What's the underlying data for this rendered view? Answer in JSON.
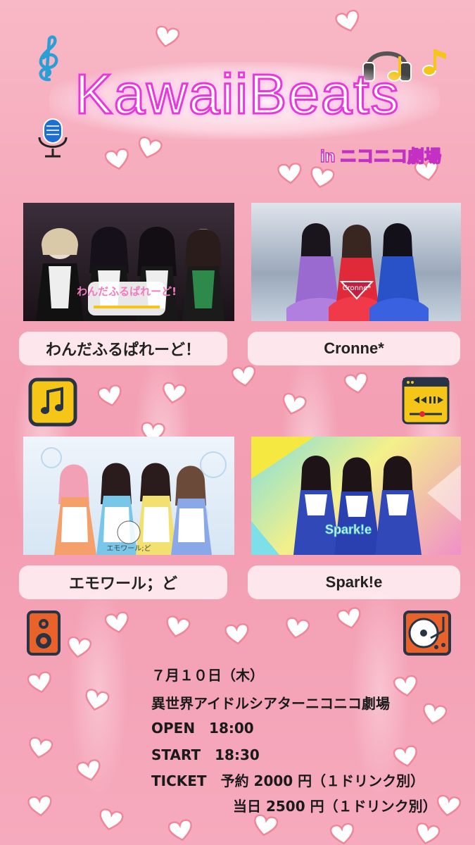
{
  "event": {
    "title": "KawaiiBeats",
    "subtitle": "in ニコニコ劇場"
  },
  "performers": [
    {
      "name": "わんだふるぱれーど！",
      "logo_text": "わんだふるぱれーど!"
    },
    {
      "name": "Cronne*",
      "logo_text": "Cronne*"
    },
    {
      "name": "エモワール；ど",
      "logo_text": "エモワール;ど"
    },
    {
      "name": "Spark!e",
      "logo_text": "Spark!e"
    }
  ],
  "details": {
    "date": "７月１０日（木）",
    "venue": "異世界アイドルシアターニコニコ劇場",
    "open": "OPEN　18:00",
    "start": "START　18:30",
    "ticket_advance": "TICKET　予約 2000 円（１ドリンク別）",
    "ticket_door": "当日 2500 円（１ドリンク別）"
  },
  "icons": [
    "treble-clef-icon",
    "headphones-icon",
    "music-notes-icon",
    "microphone-icon",
    "music-note-app-icon",
    "media-player-icon",
    "speaker-icon",
    "turntable-icon"
  ],
  "colors": {
    "background": "#f4a2b6",
    "title_stroke": "#e63ad8",
    "heart": "#ffffff",
    "heart_outline": "#f0869a"
  }
}
